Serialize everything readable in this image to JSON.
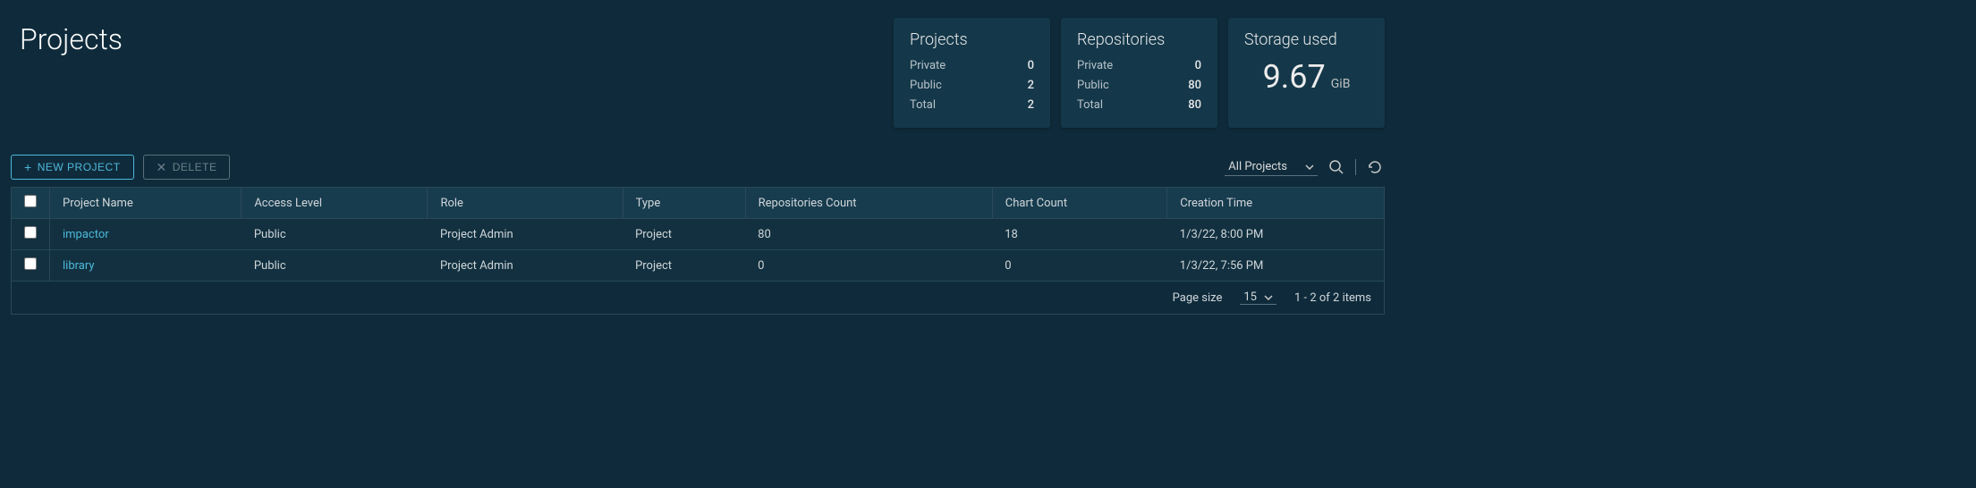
{
  "header": {
    "title": "Projects"
  },
  "stats": {
    "projects": {
      "title": "Projects",
      "private_label": "Private",
      "private_value": "0",
      "public_label": "Public",
      "public_value": "2",
      "total_label": "Total",
      "total_value": "2"
    },
    "repositories": {
      "title": "Repositories",
      "private_label": "Private",
      "private_value": "0",
      "public_label": "Public",
      "public_value": "80",
      "total_label": "Total",
      "total_value": "80"
    },
    "storage": {
      "title": "Storage used",
      "value": "9.67",
      "unit": "GiB"
    }
  },
  "toolbar": {
    "new_project": "NEW PROJECT",
    "delete": "DELETE",
    "filter_selected": "All Projects"
  },
  "table": {
    "headers": {
      "project_name": "Project Name",
      "access_level": "Access Level",
      "role": "Role",
      "type": "Type",
      "repos_count": "Repositories Count",
      "chart_count": "Chart Count",
      "creation_time": "Creation Time"
    },
    "rows": [
      {
        "name": "impactor",
        "access": "Public",
        "role": "Project Admin",
        "type": "Project",
        "repos": "80",
        "charts": "18",
        "created": "1/3/22, 8:00 PM"
      },
      {
        "name": "library",
        "access": "Public",
        "role": "Project Admin",
        "type": "Project",
        "repos": "0",
        "charts": "0",
        "created": "1/3/22, 7:56 PM"
      }
    ]
  },
  "footer": {
    "page_size_label": "Page size",
    "page_size_value": "15",
    "range_text": "1 - 2 of 2 items"
  }
}
